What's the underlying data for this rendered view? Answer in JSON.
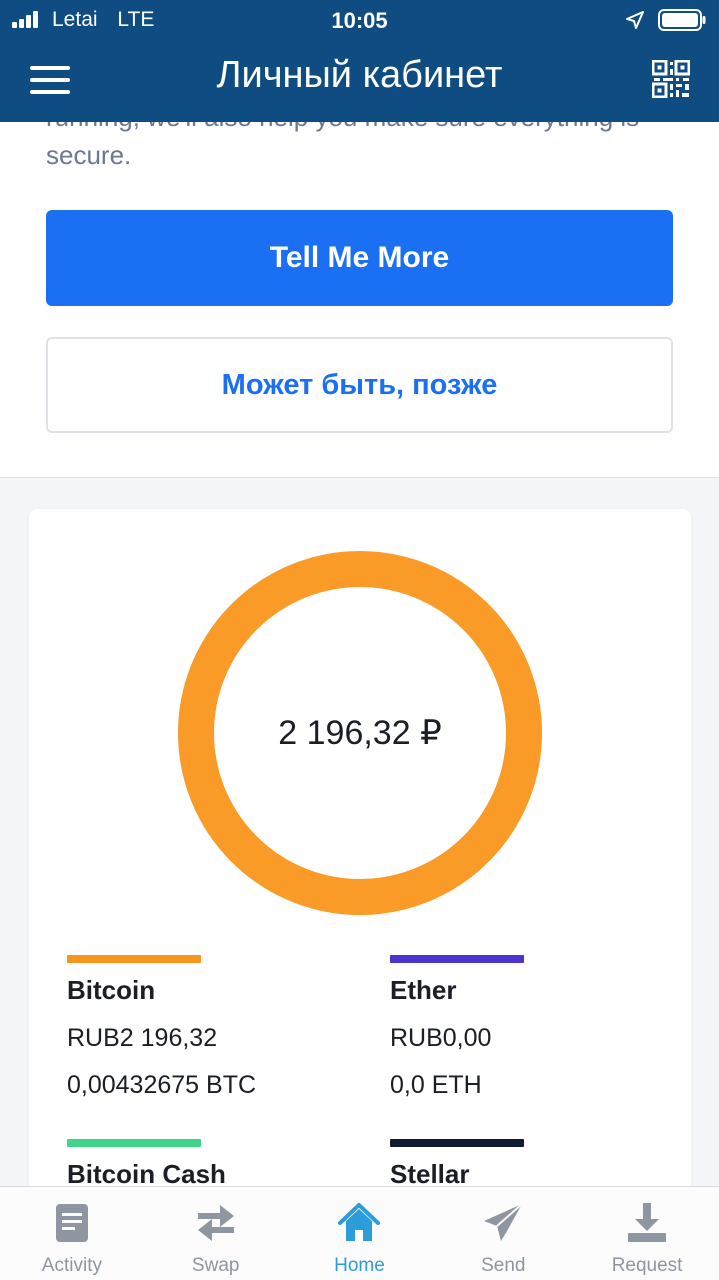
{
  "status": {
    "carrier": "Letai",
    "network": "LTE",
    "time": "10:05"
  },
  "header": {
    "title": "Личный кабинет",
    "menu_icon": "hamburger-menu-icon",
    "qr_icon": "qr-code-icon"
  },
  "promo": {
    "text": "running, we'll also help you make sure everything is secure.",
    "primary_label": "Tell Me More",
    "secondary_label": "Может быть, позже"
  },
  "portfolio": {
    "total": "2 196,32 ₽",
    "assets": [
      {
        "name": "Bitcoin",
        "fiat": "RUB2 196,32",
        "crypto": "0,00432675 BTC",
        "color": "#f7961f"
      },
      {
        "name": "Ether",
        "fiat": "RUB0,00",
        "crypto": "0,0 ETH",
        "color": "#4a35d1"
      },
      {
        "name": "Bitcoin Cash",
        "color": "#3fd68c"
      },
      {
        "name": "Stellar",
        "color": "#121a33"
      }
    ],
    "donut_color": "#f99b26"
  },
  "tabs": [
    {
      "label": "Activity",
      "icon": "activity-icon",
      "active": false
    },
    {
      "label": "Swap",
      "icon": "swap-icon",
      "active": false
    },
    {
      "label": "Home",
      "icon": "home-icon",
      "active": true
    },
    {
      "label": "Send",
      "icon": "send-icon",
      "active": false
    },
    {
      "label": "Request",
      "icon": "request-icon",
      "active": false
    }
  ],
  "colors": {
    "header": "#0f4c81",
    "primary_button": "#1a6ff2",
    "active_tab": "#2d9cdb",
    "inactive_tab": "#8e96a1"
  }
}
